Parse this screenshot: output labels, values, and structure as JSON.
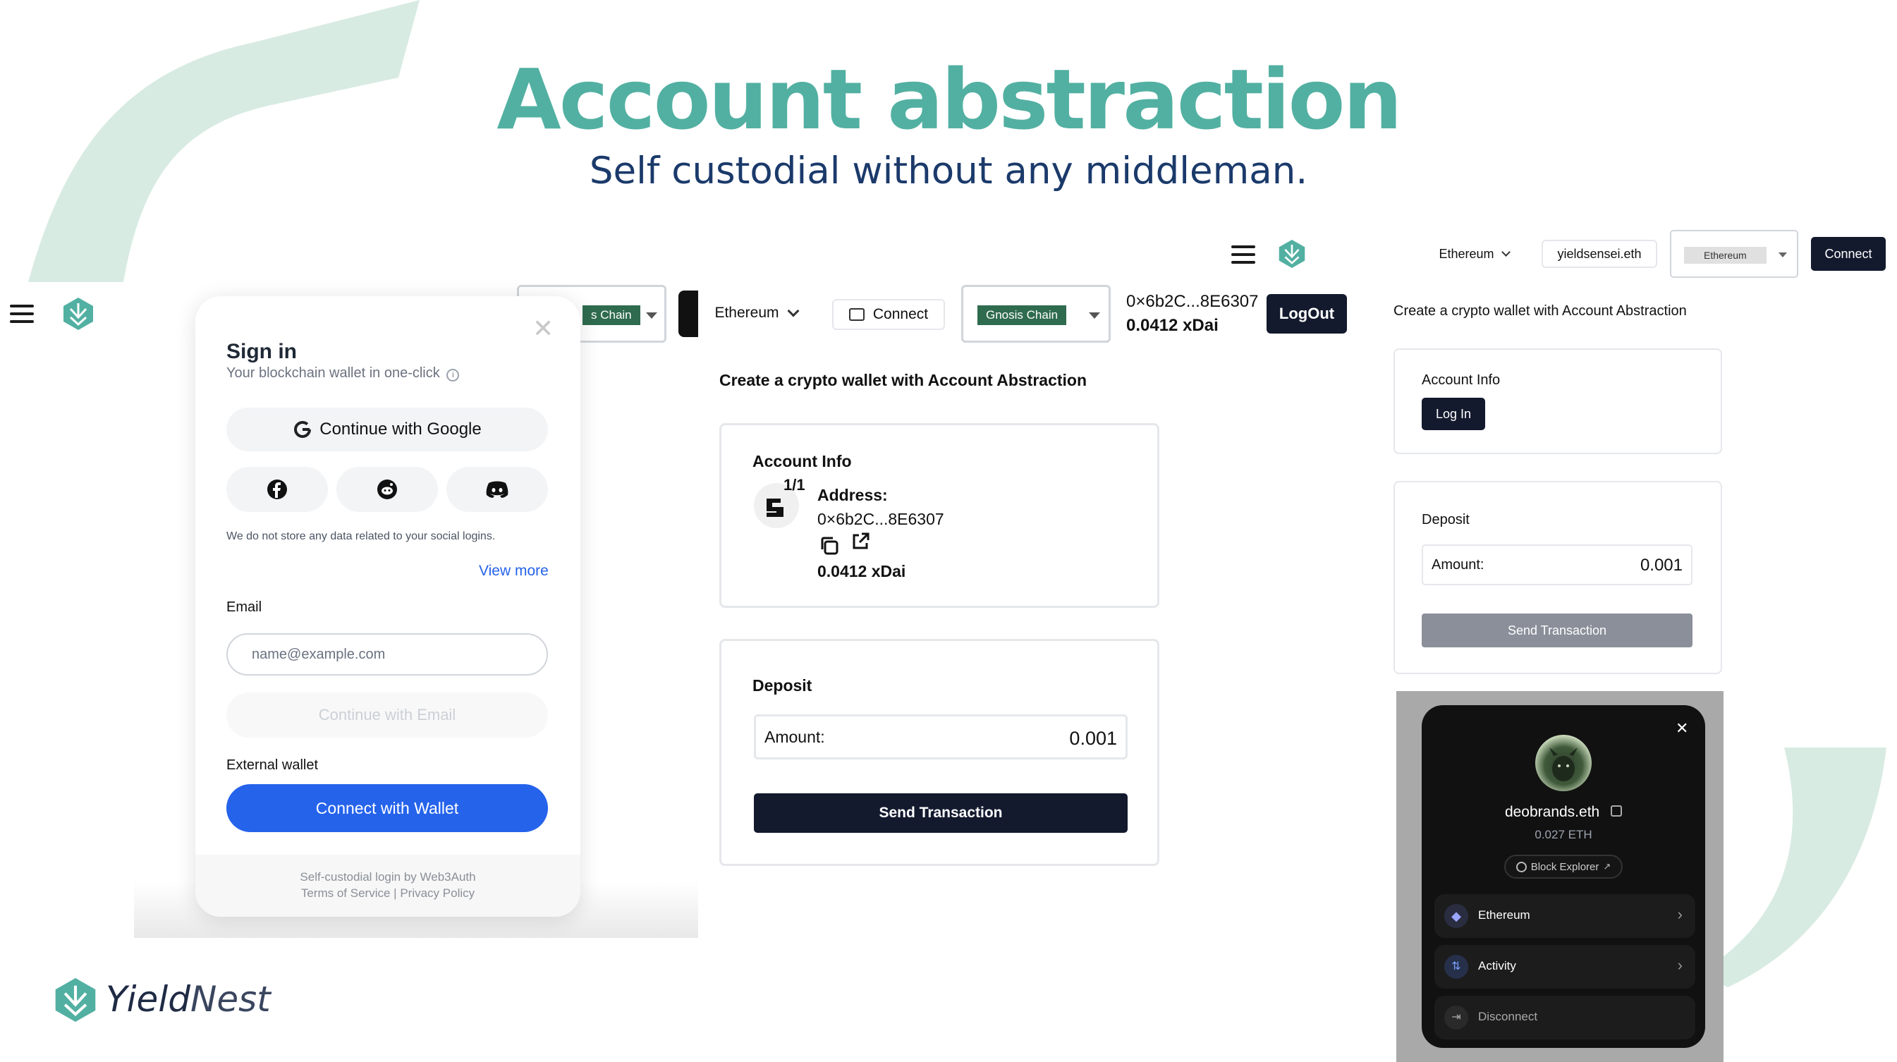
{
  "slide": {
    "title": "Account abstraction",
    "subtitle": "Self custodial without any middleman."
  },
  "brand": {
    "name_part1": "Yield",
    "name_part2": "Nest",
    "accent_color": "#52b0a2",
    "dark_color": "#131a2e",
    "blue_color": "#2563eb"
  },
  "signin": {
    "title": "Sign in",
    "subtitle": "Your blockchain wallet in one-click",
    "google_button": "Continue with Google",
    "social_note": "We do not store any data related to your social logins.",
    "view_more": "View more",
    "email_label": "Email",
    "email_placeholder": "name@example.com",
    "continue_email": "Continue with Email",
    "external_label": "External wallet",
    "connect_wallet": "Connect with Wallet",
    "footer_line1": "Self-custodial login by Web3Auth",
    "terms": "Terms of Service",
    "sep": "|",
    "privacy": "Privacy Policy",
    "social_icons": [
      "facebook-icon",
      "reddit-icon",
      "discord-icon"
    ]
  },
  "middle_header": {
    "partial_chain_label": "s Chain",
    "network_label": "Ethereum",
    "connect_label": "Connect",
    "chain_label": "Gnosis Chain",
    "address": "0×6b2C...8E6307",
    "balance": "0.0412 xDai",
    "logout_label": "LogOut"
  },
  "middle_app": {
    "heading": "Create a crypto wallet with Account Abstraction",
    "account_title": "Account Info",
    "avatar_badge": "1/1",
    "address_label": "Address:",
    "address": "0×6b2C...8E6307",
    "balance": "0.0412 xDai",
    "deposit_title": "Deposit",
    "amount_label": "Amount:",
    "amount_value": "0.001",
    "send_label": "Send Transaction"
  },
  "right_header": {
    "network_label": "Ethereum",
    "ens_label": "yieldsensei.eth",
    "chain_label": "Ethereum",
    "connect_label": "Connect"
  },
  "right_app": {
    "heading": "Create a crypto wallet with Account Abstraction",
    "account_title": "Account Info",
    "login_label": "Log In",
    "deposit_title": "Deposit",
    "amount_label": "Amount:",
    "amount_value": "0.001",
    "send_label": "Send Transaction"
  },
  "wallet_modal": {
    "ens": "deobrands.eth",
    "balance": "0.027 ETH",
    "explorer": "Block Explorer",
    "items": [
      {
        "label": "Ethereum"
      },
      {
        "label": "Activity"
      },
      {
        "label": "Disconnect"
      }
    ]
  }
}
